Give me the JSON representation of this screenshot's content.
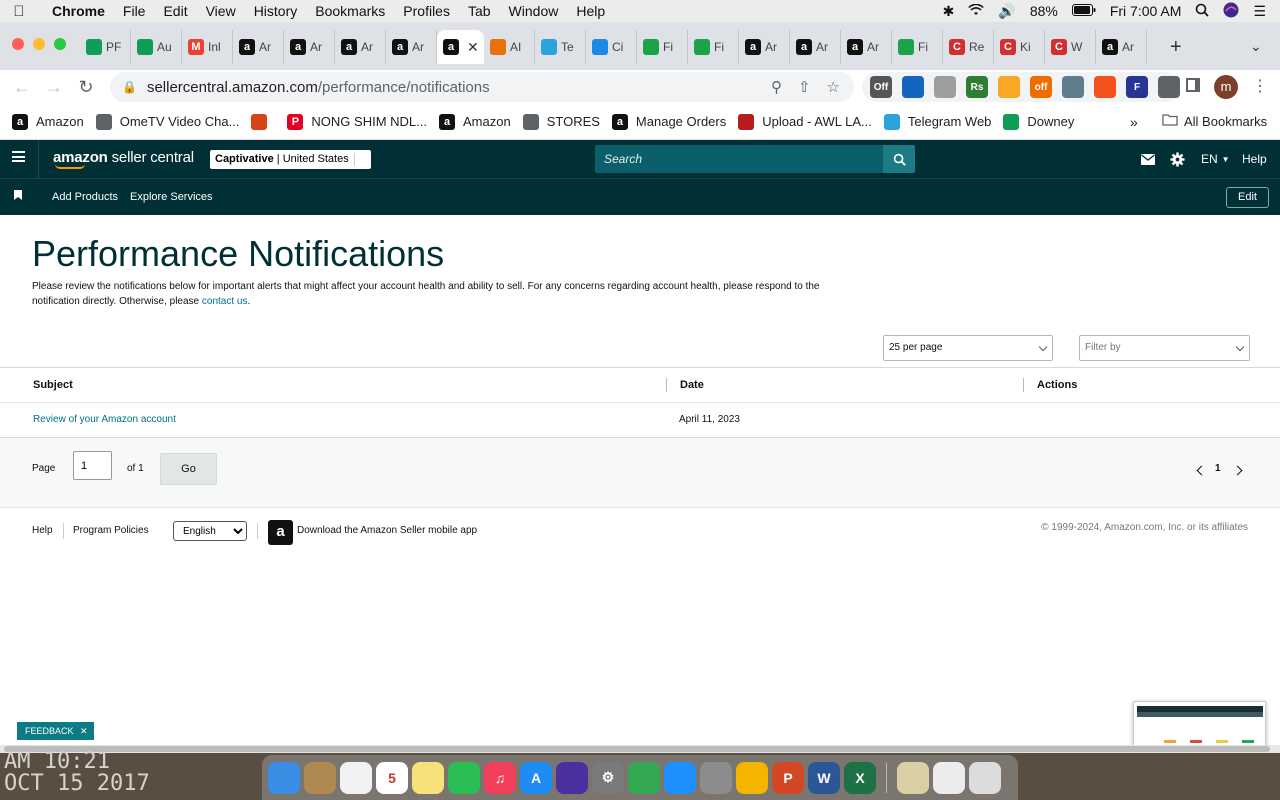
{
  "macos_menubar": {
    "app_name": "Chrome",
    "menus": [
      "File",
      "Edit",
      "View",
      "History",
      "Bookmarks",
      "Profiles",
      "Tab",
      "Window",
      "Help"
    ],
    "battery": "88%",
    "clock": "Fri 7:00 AM"
  },
  "tabs": [
    {
      "title": "PF",
      "icon": "google-sheets-icon",
      "color": "#0f9d58"
    },
    {
      "title": "Au",
      "icon": "google-sheets-icon",
      "color": "#0f9d58"
    },
    {
      "title": "Inl",
      "icon": "gmail-icon",
      "color": "#ea4335"
    },
    {
      "title": "Ar",
      "icon": "amazon-icon",
      "color": "#111111"
    },
    {
      "title": "Ar",
      "icon": "amazon-icon",
      "color": "#111111"
    },
    {
      "title": "Ar",
      "icon": "amazon-icon",
      "color": "#111111"
    },
    {
      "title": "Ar",
      "icon": "amazon-icon",
      "color": "#111111"
    },
    {
      "title": "",
      "icon": "amazon-icon",
      "color": "#111111",
      "active": true
    },
    {
      "title": "AI",
      "icon": "ai-tool-icon",
      "color": "#e8710a"
    },
    {
      "title": "Te",
      "icon": "telegram-icon",
      "color": "#2aa3df"
    },
    {
      "title": "Ci",
      "icon": "cloud-icon",
      "color": "#1e88e5"
    },
    {
      "title": "Fi",
      "icon": "finance-icon",
      "color": "#1aa34a"
    },
    {
      "title": "Fi",
      "icon": "finance-icon",
      "color": "#1aa34a"
    },
    {
      "title": "Ar",
      "icon": "amazon-icon",
      "color": "#111111"
    },
    {
      "title": "Ar",
      "icon": "amazon-icon",
      "color": "#111111"
    },
    {
      "title": "Ar",
      "icon": "amazon-icon",
      "color": "#111111"
    },
    {
      "title": "Fi",
      "icon": "finance-icon",
      "color": "#1aa34a"
    },
    {
      "title": "Re",
      "icon": "c-icon",
      "color": "#d32f2f"
    },
    {
      "title": "Ki",
      "icon": "c-icon",
      "color": "#d32f2f"
    },
    {
      "title": "W",
      "icon": "c-icon",
      "color": "#d32f2f"
    },
    {
      "title": "Ar",
      "icon": "amazon-icon",
      "color": "#111111"
    }
  ],
  "address_bar": {
    "domain": "sellercentral.amazon.com",
    "path": "/performance/notifications"
  },
  "extensions": [
    {
      "label": "Off",
      "color": "#555555"
    },
    {
      "label": "",
      "color": "#1565c0"
    },
    {
      "label": "",
      "color": "#9e9e9e"
    },
    {
      "label": "Rs",
      "color": "#2e7d32"
    },
    {
      "label": "",
      "color": "#f9a825"
    },
    {
      "label": "off",
      "color": "#ef6c00"
    },
    {
      "label": "",
      "color": "#607d8b"
    },
    {
      "label": "",
      "color": "#f4511e"
    },
    {
      "label": "F",
      "color": "#283593"
    },
    {
      "label": "",
      "color": "#5f6368"
    }
  ],
  "profile_initial": "m",
  "bookmarks": [
    {
      "label": "Amazon",
      "icon": "amazon-icon",
      "color": "#111111"
    },
    {
      "label": "OmeTV Video Cha...",
      "icon": "globe-icon",
      "color": "#5f6368"
    },
    {
      "label": "",
      "icon": "gift-icon",
      "color": "#d84315"
    },
    {
      "label": "NONG SHIM NDL...",
      "icon": "pinterest-icon",
      "color": "#e60023"
    },
    {
      "label": "Amazon",
      "icon": "amazon-icon",
      "color": "#111111"
    },
    {
      "label": "STORES",
      "icon": "folder-icon",
      "color": "#5f6368"
    },
    {
      "label": "Manage Orders",
      "icon": "amazon-icon",
      "color": "#111111"
    },
    {
      "label": "Upload - AWL LA...",
      "icon": "awl-icon",
      "color": "#b71c1c"
    },
    {
      "label": "Telegram Web",
      "icon": "telegram-icon",
      "color": "#2aa3df"
    },
    {
      "label": "Downey",
      "icon": "google-sheets-icon",
      "color": "#0f9d58"
    }
  ],
  "bookmarks_more": "»",
  "all_bookmarks": "All Bookmarks",
  "seller_central": {
    "logo_main": "amazon",
    "logo_sub": "seller central",
    "store_name": "Captivative",
    "store_region": "United States",
    "search_placeholder": "Search",
    "language": "EN",
    "help": "Help",
    "subnav": [
      "Add Products",
      "Explore Services"
    ],
    "edit": "Edit"
  },
  "content": {
    "title": "Performance Notifications",
    "intro": "Please review the notifications below for important alerts that might affect your account health and ability to sell. For any concerns regarding account health, please respond to the notification directly. Otherwise, please",
    "contact_link": "contact us",
    "intro_end": ".",
    "per_page": "25 per page",
    "filter_placeholder": "Filter by",
    "table": {
      "headers": [
        "Subject",
        "Date",
        "Actions"
      ],
      "rows": [
        {
          "subject": "Review of your Amazon account",
          "date": "April 11, 2023",
          "actions": ""
        }
      ]
    },
    "pagination": {
      "page_label": "Page",
      "current": "1",
      "of_label": "of 1",
      "go": "Go",
      "page_indicator": "1"
    }
  },
  "footer": {
    "help": "Help",
    "policies": "Program Policies",
    "language": "English",
    "app_text": "Download the Amazon Seller mobile app",
    "copyright": "© 1999-2024, Amazon.com, Inc. or its affiliates"
  },
  "feedback": "FEEDBACK",
  "wallpaper_text": "AM 10:21\nOCT 15 2017",
  "dock": [
    {
      "name": "finder-icon",
      "color": "#3a8ee6",
      "label": ""
    },
    {
      "name": "contacts-icon",
      "color": "#b08852",
      "label": ""
    },
    {
      "name": "reminders-icon",
      "color": "#f2f2f2",
      "label": ""
    },
    {
      "name": "calendar-icon",
      "color": "#ffffff",
      "label": "5"
    },
    {
      "name": "notes-icon",
      "color": "#f7e27a",
      "label": ""
    },
    {
      "name": "facetime-icon",
      "color": "#2dbd55",
      "label": ""
    },
    {
      "name": "music-icon",
      "color": "#f2405a",
      "label": "♫"
    },
    {
      "name": "app-store-icon",
      "color": "#1d8df5",
      "label": "A"
    },
    {
      "name": "siri-icon",
      "color": "#4b2fa0",
      "label": ""
    },
    {
      "name": "system-preferences-icon",
      "color": "#7a7a7a",
      "label": "⚙"
    },
    {
      "name": "chrome-icon",
      "color": "#34a853",
      "label": ""
    },
    {
      "name": "safari-icon",
      "color": "#1e90ff",
      "label": ""
    },
    {
      "name": "launchpad-icon",
      "color": "#8c8c8c",
      "label": ""
    },
    {
      "name": "photos-icon",
      "color": "#f5b400",
      "label": ""
    },
    {
      "name": "powerpoint-icon",
      "color": "#d24726",
      "label": "P"
    },
    {
      "name": "word-icon",
      "color": "#2b5797",
      "label": "W"
    },
    {
      "name": "excel-icon",
      "color": "#1e7145",
      "label": "X"
    }
  ],
  "dock_right": [
    {
      "name": "downloads-icon",
      "color": "#d9cfa4"
    },
    {
      "name": "documents-icon",
      "color": "#ececec"
    },
    {
      "name": "trash-icon",
      "color": "#dcdcdc"
    }
  ]
}
